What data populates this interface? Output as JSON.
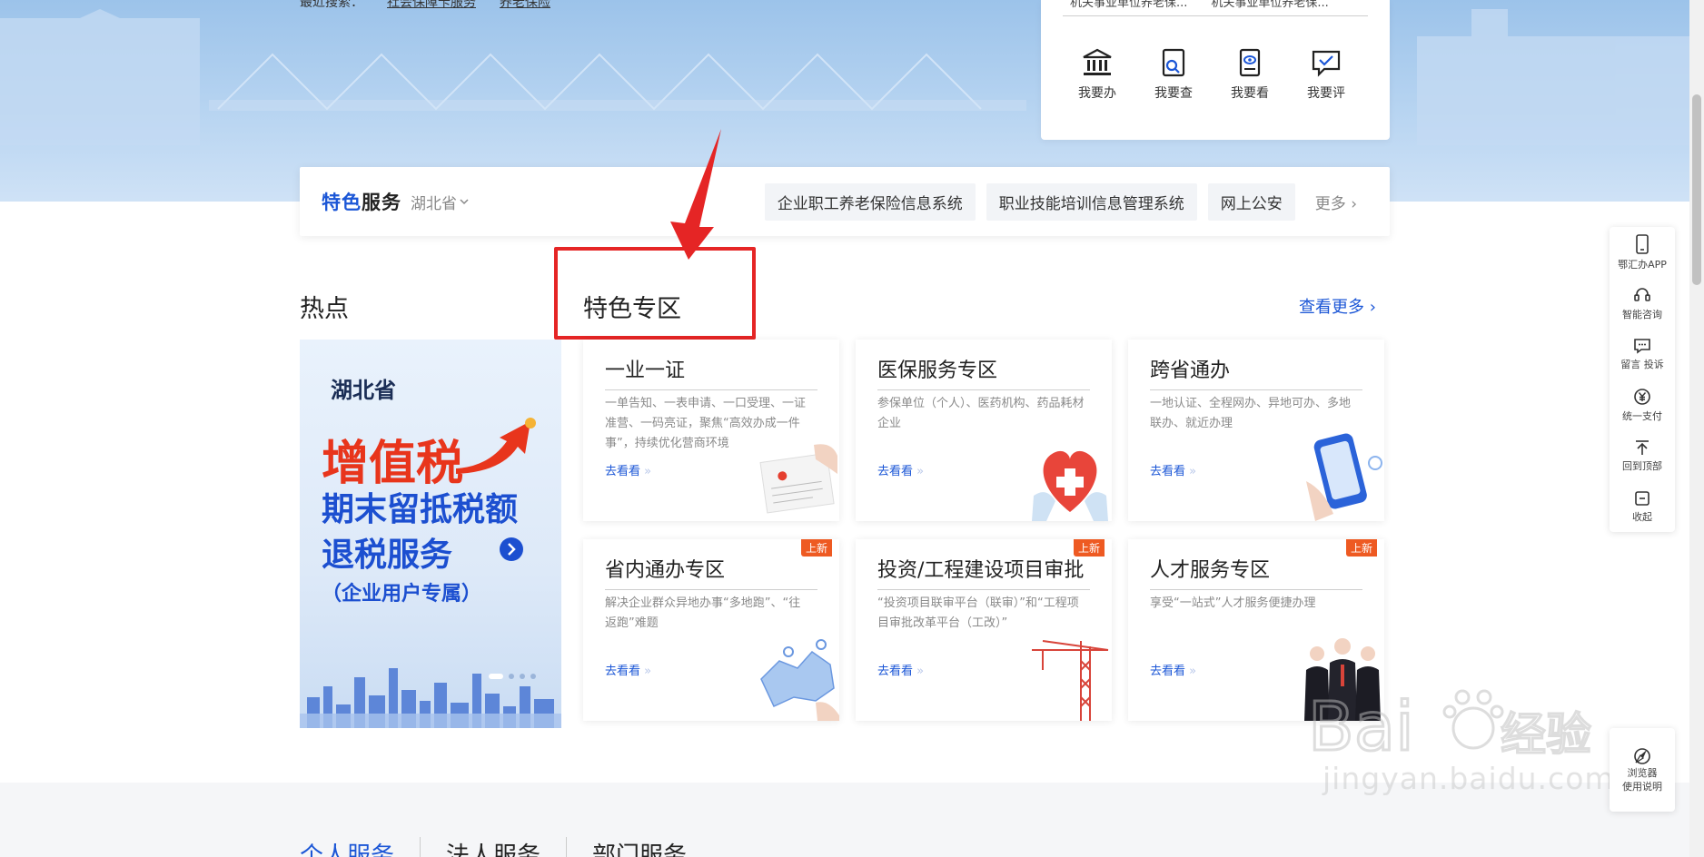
{
  "hero": {
    "links": [
      "最近搜索：",
      "社会保障卡服务",
      "养老保险"
    ]
  },
  "quick_access": {
    "news": [
      "机关事业单位养老保...",
      "机关事业单位养老保..."
    ],
    "items": [
      {
        "label": "我要办",
        "icon": "bank-building-icon"
      },
      {
        "label": "我要查",
        "icon": "search-document-icon"
      },
      {
        "label": "我要看",
        "icon": "eye-document-icon"
      },
      {
        "label": "我要评",
        "icon": "comment-check-icon"
      }
    ]
  },
  "feature_bar": {
    "title_accent": "特色",
    "title_dark": "服务",
    "region": "湖北省",
    "links": [
      "企业职工养老保险信息系统",
      "职业技能培训信息管理系统",
      "网上公安"
    ],
    "more": "更多"
  },
  "section": {
    "hot": "热点",
    "zone": "特色专区",
    "view_more": "查看更多"
  },
  "banner": {
    "province": "湖北省",
    "headline": "增值税",
    "line1": "期末留抵税额",
    "line2": "退税服务",
    "line3": "（企业用户专属）"
  },
  "cards": [
    {
      "title": "一业一证",
      "desc": "一单告知、一表申请、一口受理、一证准营、一码亮证，聚焦“高效办成一件事”，持续优化营商环境",
      "link": "去看看",
      "badge": ""
    },
    {
      "title": "医保服务专区",
      "desc": "参保单位（个人）、医药机构、药品耗材企业",
      "link": "去看看",
      "badge": ""
    },
    {
      "title": "跨省通办",
      "desc": "一地认证、全程网办、异地可办、多地联办、就近办理",
      "link": "去看看",
      "badge": ""
    },
    {
      "title": "省内通办专区",
      "desc": "解决企业群众异地办事“多地跑”、“往返跑”难题",
      "link": "去看看",
      "badge": "上新"
    },
    {
      "title": "投资/工程建设项目审批",
      "desc": "“投资项目联审平台（联审）”和“工程项目审批改革平台（工改）”",
      "link": "去看看",
      "badge": "上新"
    },
    {
      "title": "人才服务专区",
      "desc": "享受“一站式”人才服务便捷办理",
      "link": "去看看",
      "badge": "上新"
    }
  ],
  "lower_tabs": [
    "个人服务",
    "法人服务",
    "部门服务"
  ],
  "side_bar": [
    {
      "label": "鄂汇办APP",
      "icon": "phone-icon"
    },
    {
      "label": "智能咨询",
      "icon": "headset-icon"
    },
    {
      "label": "留言 投诉",
      "icon": "message-icon"
    },
    {
      "label": "统一支付",
      "icon": "yuan-icon"
    },
    {
      "label": "回到顶部",
      "icon": "back-to-top-icon"
    },
    {
      "label": "收起",
      "icon": "collapse-icon"
    }
  ],
  "browser_help": {
    "line1": "浏览器",
    "line2": "使用说明"
  },
  "watermark": {
    "text": "jingyan.baidu.com"
  },
  "colors": {
    "brand_blue": "#1b56d6",
    "badge_orange": "#ee5a22",
    "annotation_red": "#e52525"
  }
}
